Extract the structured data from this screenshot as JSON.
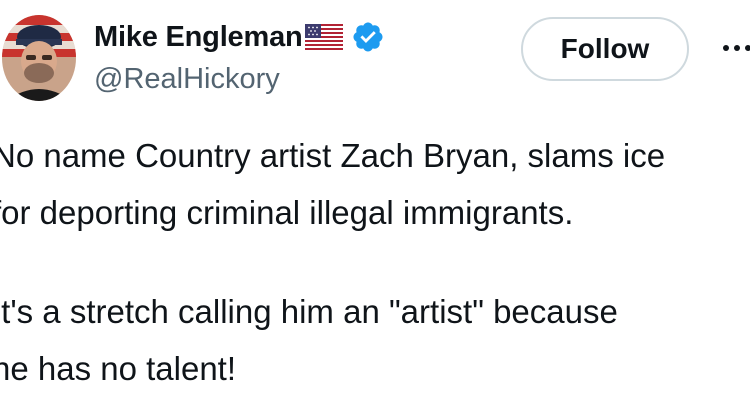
{
  "author": {
    "display_name": "Mike Engleman",
    "handle": "@RealHickory",
    "flag_emoji_icon": "us-flag-icon",
    "verified_icon": "verified-badge-icon",
    "verified_color": "#1d9bf0"
  },
  "actions": {
    "follow_label": "Follow",
    "more_icon": "more-options-icon"
  },
  "tweet": {
    "lines": [
      "No name Country artist Zach Bryan, slams ice",
      "for deporting criminal illegal immigrants.",
      "It's a stretch calling him an \"artist\" because",
      "he has no talent!"
    ]
  },
  "colors": {
    "text": "#0f1419",
    "secondary": "#536471",
    "button_border": "#cfd9de"
  }
}
